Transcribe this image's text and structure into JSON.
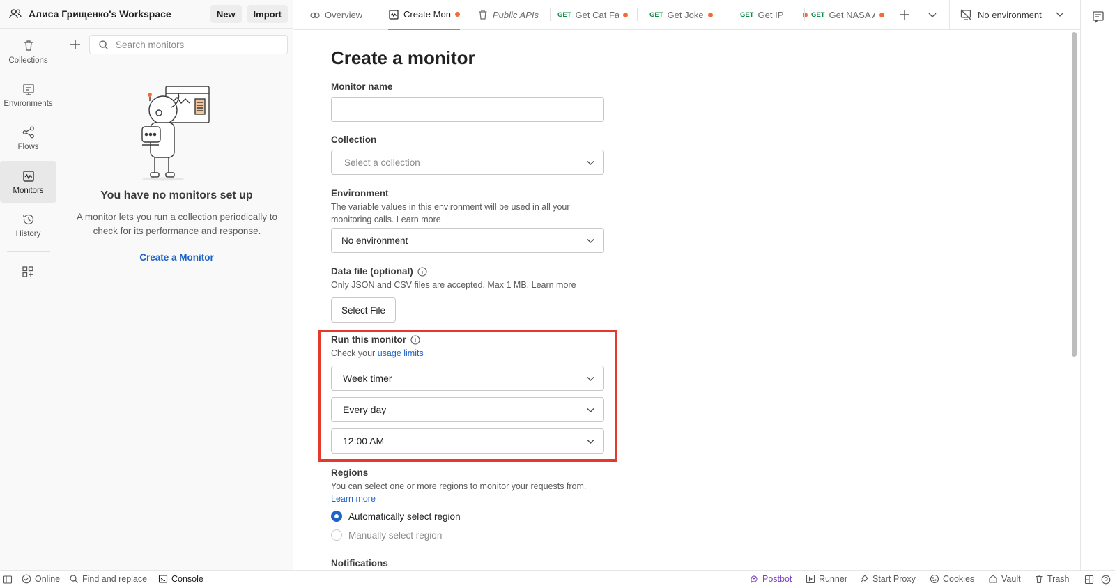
{
  "workspace": {
    "name": "Алиса Грищенко's Workspace",
    "new_label": "New",
    "import_label": "Import"
  },
  "rail": {
    "items": [
      {
        "label": "Collections",
        "icon": "trash-can-icon"
      },
      {
        "label": "Environments",
        "icon": "environment-icon"
      },
      {
        "label": "Flows",
        "icon": "flows-icon"
      },
      {
        "label": "Monitors",
        "icon": "monitor-icon",
        "active": true
      },
      {
        "label": "History",
        "icon": "history-icon"
      }
    ]
  },
  "panel": {
    "search_placeholder": "Search monitors",
    "empty_title": "You have no monitors set up",
    "empty_desc": "A monitor lets you run a collection periodically to check for its performance and response.",
    "create_link": "Create a Monitor"
  },
  "tabs": [
    {
      "label": "Overview",
      "icon": "overview-icon"
    },
    {
      "label": "Create Mon",
      "icon": "monitor-icon",
      "active": true,
      "unsaved": true
    },
    {
      "label": "Public APIs",
      "icon": "collection-icon",
      "italic": true
    },
    {
      "method": "GET",
      "label": "Get Cat Fa",
      "unsaved": true
    },
    {
      "method": "GET",
      "label": "Get Joke",
      "unsaved": true
    },
    {
      "method": "GET",
      "label": "Get IP",
      "unsaved": true
    },
    {
      "method": "GET",
      "label": "Get NASA A",
      "unsaved": true
    }
  ],
  "environment_selector": "No environment",
  "form": {
    "title": "Create a monitor",
    "monitor_name_label": "Monitor name",
    "monitor_name_value": "",
    "collection_label": "Collection",
    "collection_placeholder": "Select a collection",
    "environment_label": "Environment",
    "environment_help": "The variable values in this environment will be used in all your monitoring calls. Learn more",
    "environment_value": "No environment",
    "data_file_label": "Data file (optional)",
    "data_file_help": "Only JSON and CSV files are accepted. Max 1 MB. Learn more",
    "select_file_label": "Select File",
    "run_label": "Run this monitor",
    "run_help_prefix": "Check your",
    "run_help_link": "usage limits",
    "timer_value": "Week timer",
    "day_value": "Every day",
    "time_value": "12:00 AM",
    "regions_label": "Regions",
    "regions_help": "You can select one or more regions to monitor your requests from.",
    "regions_link": "Learn more",
    "region_auto": "Automatically select region",
    "region_manual": "Manually select region",
    "region_selected": "auto",
    "notifications_label": "Notifications"
  },
  "statusbar": {
    "online": "Online",
    "find_replace": "Find and replace",
    "console": "Console",
    "postbot": "Postbot",
    "runner": "Runner",
    "start_proxy": "Start Proxy",
    "cookies": "Cookies",
    "vault": "Vault",
    "trash": "Trash"
  },
  "colors": {
    "accent": "#f26b3a",
    "link": "#1d63c7",
    "highlight": "#e53a2b",
    "get_method": "#0f8a47",
    "postbot": "#7b3fc4"
  }
}
